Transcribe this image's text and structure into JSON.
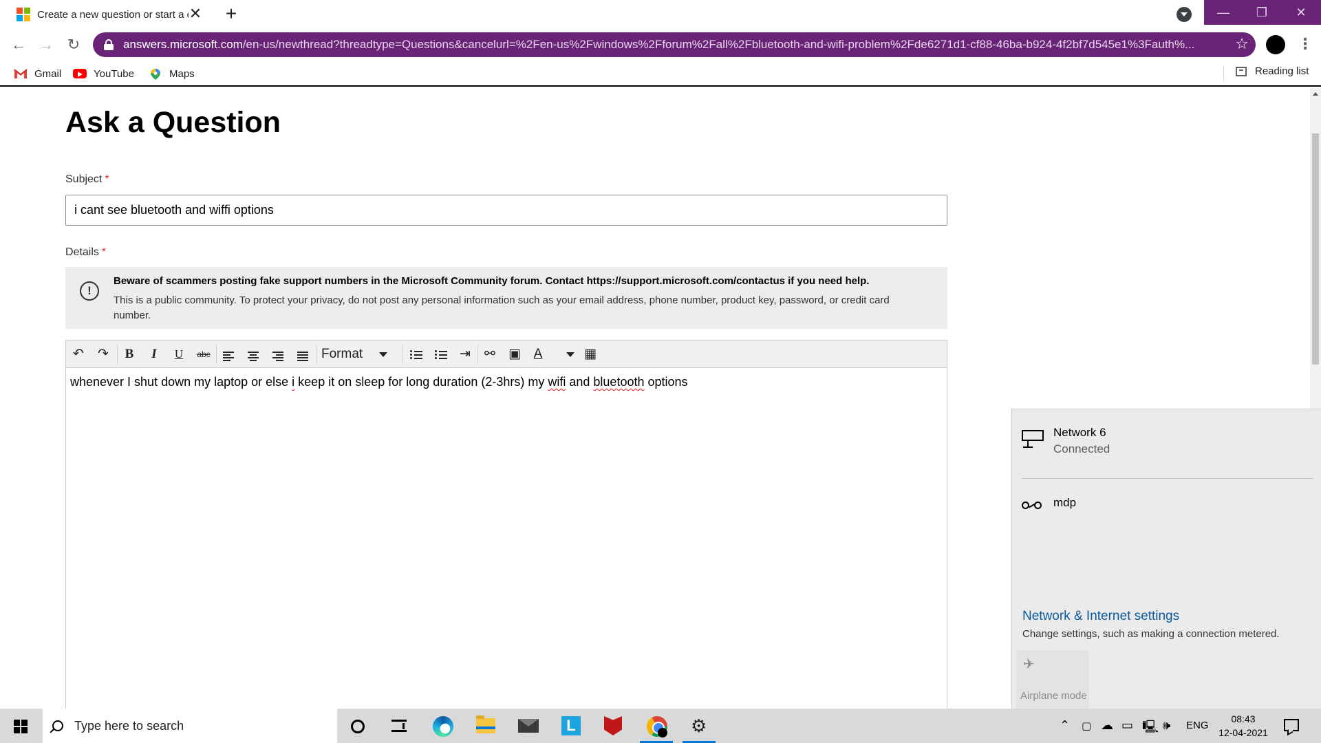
{
  "browser": {
    "tab_title": "Create a new question or start a discussion",
    "tab_close": "✕",
    "new_tab": "+",
    "window_controls": {
      "minimize": "—",
      "restore": "❐",
      "close": "✕"
    },
    "url_host": "answers.microsoft.com",
    "url_path": "/en-us/newthread?threadtype=Questions&cancelurl=%2Fen-us%2Fwindows%2Fforum%2Fall%2Fbluetooth-and-wifi-problem%2Fde6271d1-cf88-46ba-b924-4f2bf7d545e1%3Fauth%...",
    "bookmarks": [
      "Gmail",
      "YouTube",
      "Maps"
    ],
    "reading_list": "Reading list",
    "theme_color": "#6a2477"
  },
  "page": {
    "title": "Ask a Question",
    "subject_label": "Subject",
    "required_mark": "*",
    "subject_value": "i cant see bluetooth and wiffi options",
    "details_label": "Details",
    "notice_icon": "!",
    "notice_bold": "Beware of scammers posting fake support numbers in the Microsoft Community forum. Contact https://support.microsoft.com/contactus if you need help.",
    "notice_text": "This is a public community. To protect your privacy, do not post any personal information such as your email address, phone number, product key, password, or credit card number.",
    "editor": {
      "format_label": "Format",
      "tool_icons": {
        "undo": "↶",
        "redo": "↷",
        "bold": "B",
        "italic": "I",
        "underline": "U",
        "strike": "abc",
        "link": "⚯",
        "image": "▣",
        "text_color": "A",
        "table": "▦",
        "indent": "⇥"
      },
      "body": {
        "part1": "whenever I shut down my laptop or else ",
        "w1": "i",
        "part2": " keep it on sleep for long duration (2-3hrs) my ",
        "w2": "wifi",
        "part3": " and ",
        "w3": "bluetooth",
        "part4": " options"
      }
    }
  },
  "network_flyout": {
    "network_name": "Network 6",
    "network_status": "Connected",
    "dialup_name": "mdp",
    "settings_link": "Network & Internet settings",
    "settings_sub": "Change settings, such as making a connection metered.",
    "airplane_icon": "✈",
    "quick_action": "Airplane mode"
  },
  "taskbar": {
    "search_placeholder": "Type here to search",
    "language": "ENG",
    "time": "08:43",
    "date": "12-04-2021",
    "settings_icon": "⚙",
    "l_app": "L",
    "tray_icons": {
      "chevron": "⌃",
      "meet": "▢",
      "onedrive": "☁",
      "battery": "▭",
      "network": "🖳",
      "volume": "🕪"
    }
  }
}
